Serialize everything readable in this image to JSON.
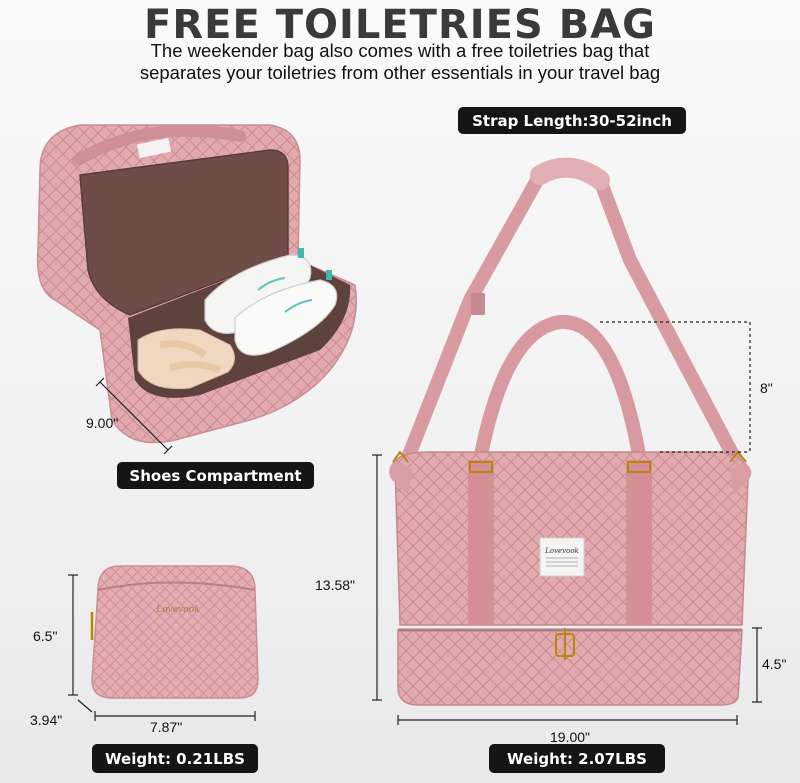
{
  "header": {
    "title": "FREE TOILETRIES BAG",
    "subtitle_line1": "The weekender bag also comes with a free toiletries bag that",
    "subtitle_line2": "separates your toiletries from other essentials in your  travel bag"
  },
  "labels": {
    "strap_length": "Strap Length:30-52inch",
    "shoes_compartment": "Shoes Compartment",
    "toiletry_weight": "Weight:  0.21LBS",
    "duffel_weight": "Weight:  2.07LBS"
  },
  "dimensions": {
    "shoe_depth": "9.00\"",
    "handle_drop": "8\"",
    "bag_height": "13.58\"",
    "bottom_height": "4.5\"",
    "bag_width": "19.00\"",
    "pouch_height": "6.5\"",
    "pouch_depth": "3.94\"",
    "pouch_width": "7.87\""
  },
  "brand": {
    "name": "Lovevook"
  },
  "colors": {
    "bag_pink": "#e2a9ae",
    "bag_pink_dark": "#cf8f96",
    "lining_brown": "#6e4d48",
    "label_bg": "#151515"
  }
}
